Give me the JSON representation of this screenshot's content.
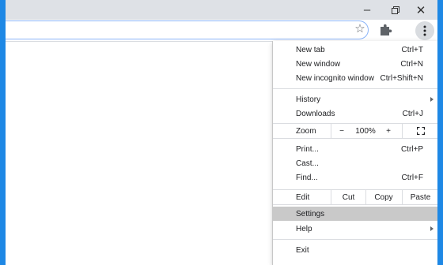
{
  "window": {
    "minimize_glyph": "–",
    "restore_glyph": "❐",
    "close_glyph": "✕"
  },
  "toolbar": {
    "bookmark_icon": "star-icon",
    "extensions_icon": "puzzle-icon",
    "menu_icon": "three-dots-vertical-icon"
  },
  "menu": {
    "new_tab": {
      "label": "New tab",
      "shortcut": "Ctrl+T"
    },
    "new_window": {
      "label": "New window",
      "shortcut": "Ctrl+N"
    },
    "new_incognito": {
      "label": "New incognito window",
      "shortcut": "Ctrl+Shift+N"
    },
    "history": {
      "label": "History"
    },
    "downloads": {
      "label": "Downloads",
      "shortcut": "Ctrl+J"
    },
    "zoom": {
      "label": "Zoom",
      "minus": "−",
      "value": "100%",
      "plus": "+"
    },
    "print": {
      "label": "Print...",
      "shortcut": "Ctrl+P"
    },
    "cast": {
      "label": "Cast..."
    },
    "find": {
      "label": "Find...",
      "shortcut": "Ctrl+F"
    },
    "edit": {
      "label": "Edit",
      "cut": "Cut",
      "copy": "Copy",
      "paste": "Paste"
    },
    "settings": {
      "label": "Settings"
    },
    "help": {
      "label": "Help"
    },
    "exit": {
      "label": "Exit"
    }
  },
  "colors": {
    "frame": "#1e88e5",
    "titlebar": "#dee1e6",
    "highlight": "#c9c9c9",
    "focus_ring": "#8ab4f8"
  }
}
